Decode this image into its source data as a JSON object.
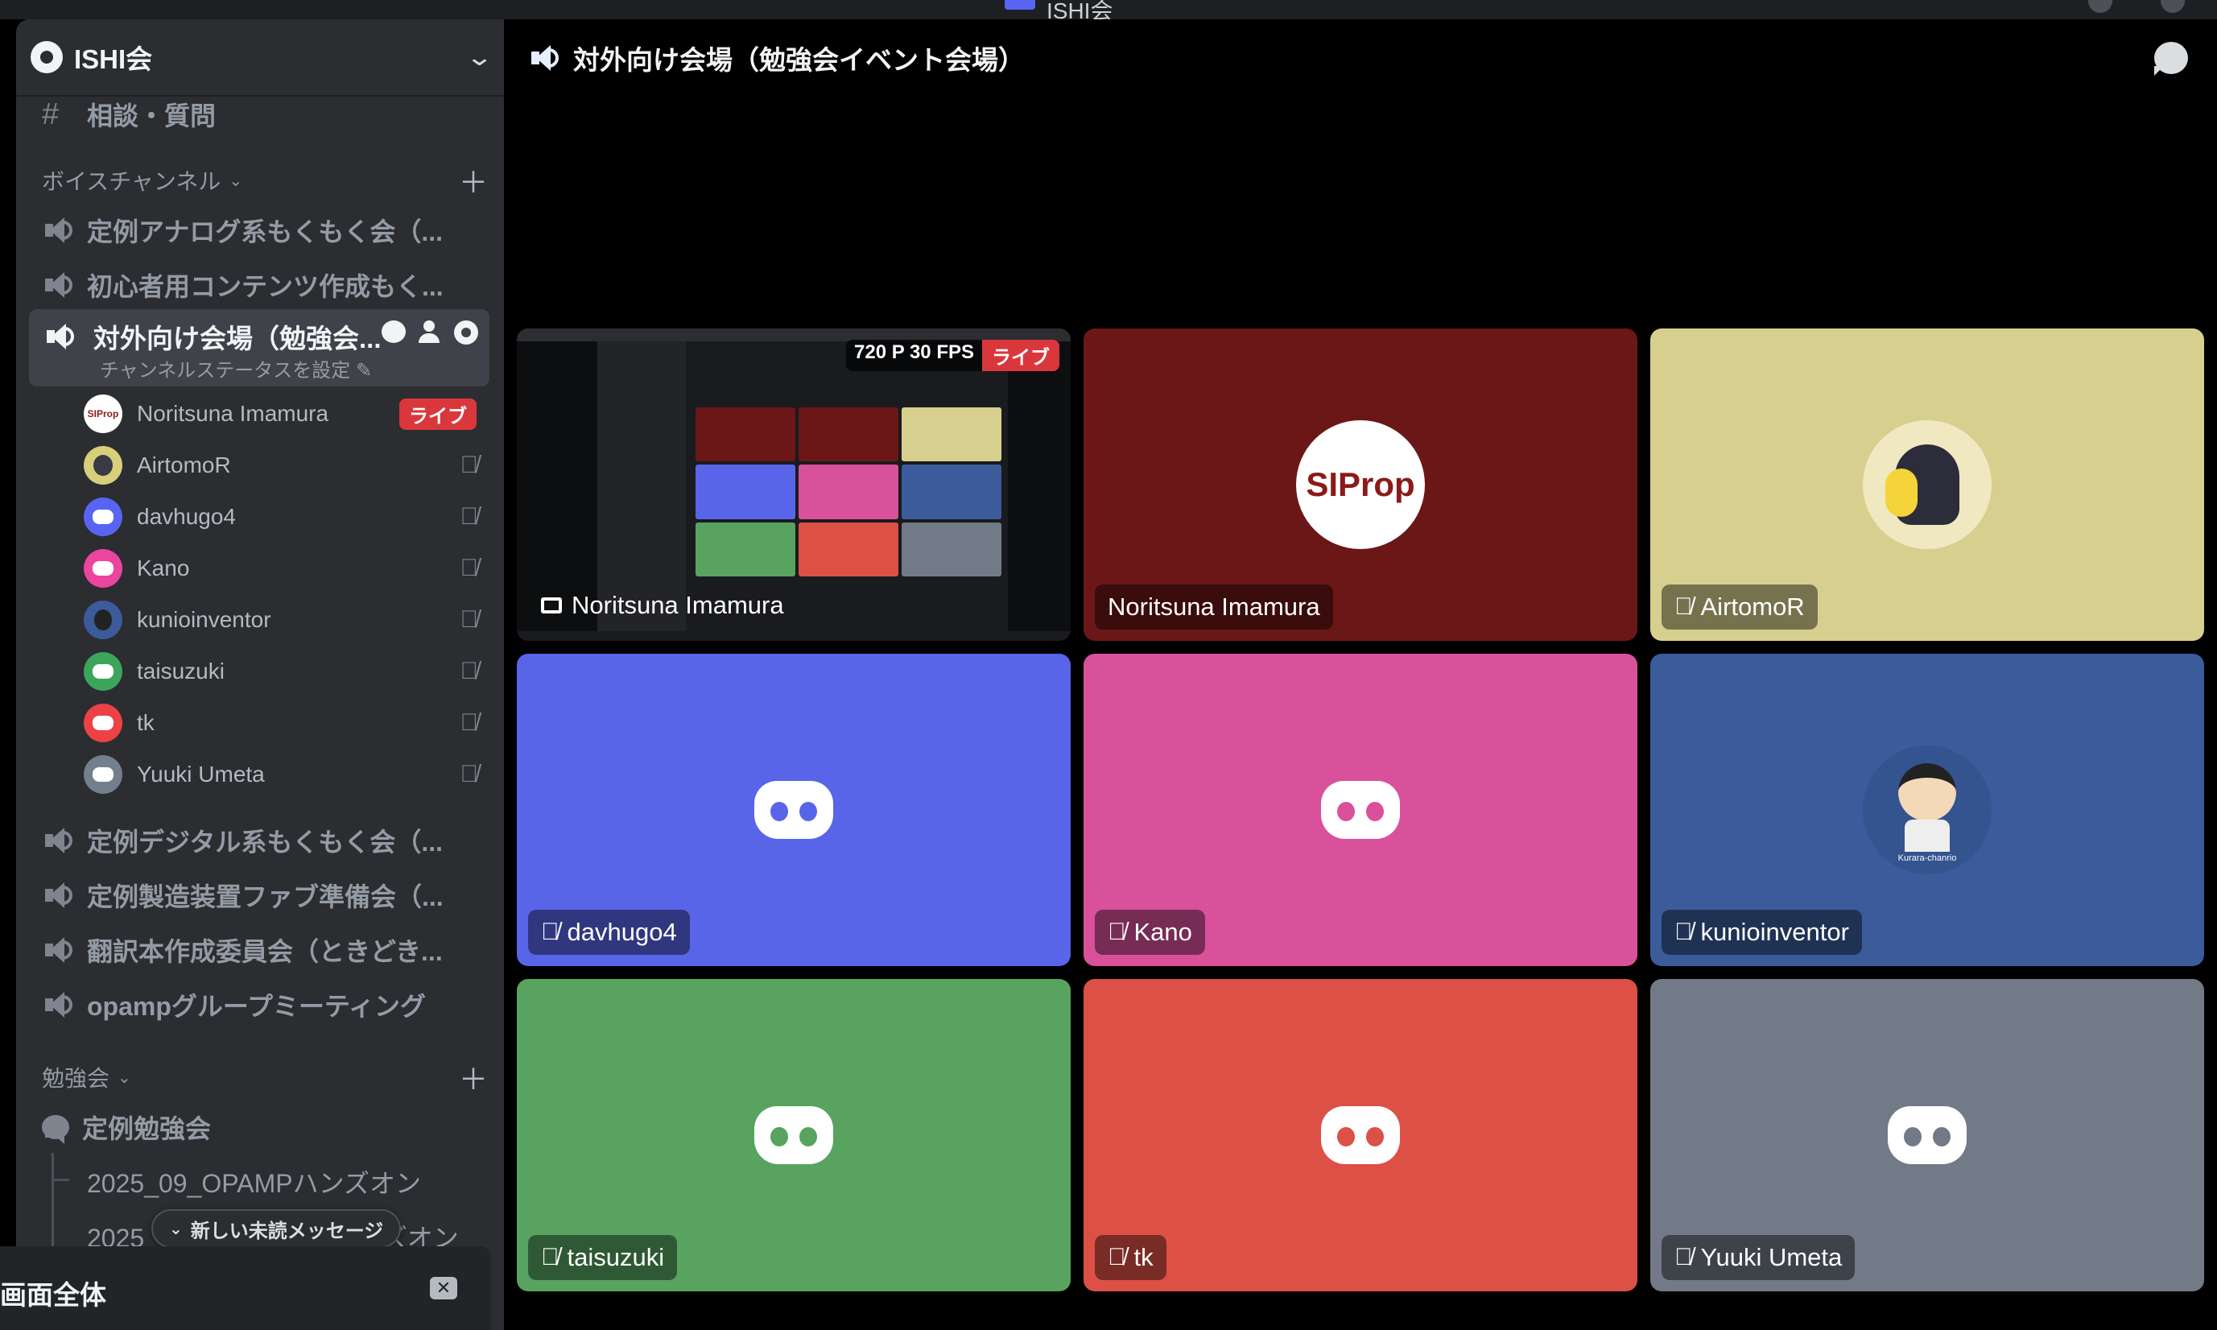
{
  "window": {
    "title": "ISHI会"
  },
  "server": {
    "name": "ISHI会"
  },
  "sidebar": {
    "partial_channel": "相談・質問",
    "voice_category": "ボイスチャンネル",
    "voice_channels": [
      "定例アナログ系もくもく会（...",
      "初心者用コンテンツ作成もく..."
    ],
    "active_channel": {
      "name": "対外向け会場（勉強会...",
      "status": "チャンネルステータスを設定"
    },
    "members": [
      {
        "name": "Noritsuna Imamura",
        "badge": "ライブ",
        "avatar_color": "#ffffff"
      },
      {
        "name": "AirtomoR",
        "avatar_color": "#d7cf7a"
      },
      {
        "name": "davhugo4",
        "avatar_color": "#5865f2"
      },
      {
        "name": "Kano",
        "avatar_color": "#eb459f"
      },
      {
        "name": "kunioinventor",
        "avatar_color": "#3b5b9a"
      },
      {
        "name": "taisuzuki",
        "avatar_color": "#3ba55c"
      },
      {
        "name": "tk",
        "avatar_color": "#ed4245"
      },
      {
        "name": "Yuuki Umeta",
        "avatar_color": "#747f8d"
      }
    ],
    "more_voice_channels": [
      "定例デジタル系もくもく会（...",
      "定例製造装置ファブ準備会（...",
      "翻訳本作成委員会（ときどき...",
      "opampグループミーティング"
    ],
    "study_category": "勉強会",
    "forum": "定例勉強会",
    "threads": [
      "2025_09_OPAMPハンズオン",
      "2025_09_初心者向けハンズオン"
    ],
    "new_messages": "新しい未読メッセージ",
    "screen_share": "画面全体"
  },
  "main": {
    "title": "対外向け会場（勉強会イベント会場）",
    "stream": {
      "name": "Noritsuna Imamura",
      "quality": "720 P 30 FPS",
      "live": "ライブ"
    },
    "tiles": [
      {
        "name": "Noritsuna Imamura",
        "color": "#6b1717",
        "avatar": "SIProp",
        "muted": false
      },
      {
        "name": "AirtomoR",
        "color": "#d7cf8e",
        "muted": true
      },
      {
        "name": "davhugo4",
        "color": "#5865e8",
        "muted": true
      },
      {
        "name": "Kano",
        "color": "#d9509b",
        "muted": true
      },
      {
        "name": "kunioinventor",
        "color": "#3b5b9a",
        "avatar_caption": "Kurara-chanrio",
        "muted": true
      },
      {
        "name": "taisuzuki",
        "color": "#57a35f",
        "muted": true
      },
      {
        "name": "tk",
        "color": "#dc5046",
        "muted": true
      },
      {
        "name": "Yuuki Umeta",
        "color": "#727a87",
        "muted": true
      }
    ]
  },
  "icons": {
    "muted": "mic-off-icon",
    "speaker": "speaker-icon",
    "chat": "chat-bubble-icon"
  }
}
